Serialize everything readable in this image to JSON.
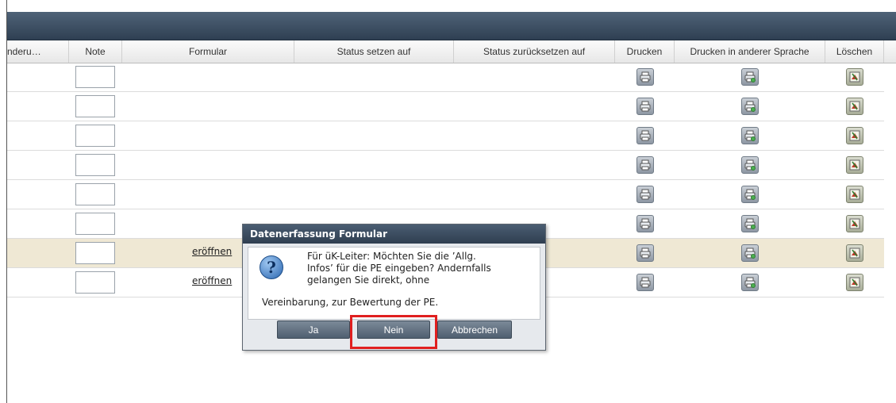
{
  "columns": [
    "nderu…",
    "Note",
    "Formular",
    "Status setzen auf",
    "Status zurücksetzen auf",
    "Drucken",
    "Drucken in anderer Sprache",
    "Löschen"
  ],
  "rows": [
    {
      "formular_link": ""
    },
    {
      "formular_link": ""
    },
    {
      "formular_link": ""
    },
    {
      "formular_link": ""
    },
    {
      "formular_link": ""
    },
    {
      "formular_link": ""
    },
    {
      "formular_link": "eröffnen",
      "highlight": true
    },
    {
      "formular_link": "eröffnen"
    }
  ],
  "icons": {
    "print": "printer-icon",
    "print_other_language": "printer-language-icon",
    "delete": "delete-icon"
  },
  "dialog": {
    "title": "Datenerfassung Formular",
    "message_line1": "Für üK-Leiter: Möchten Sie die ’Allg.",
    "message_line2": "Infos’ für die PE eingeben? Andernfalls",
    "message_line3": "gelangen Sie direkt, ohne",
    "message_line4": "Vereinbarung, zur Bewertung der PE.",
    "buttons": {
      "yes": "Ja",
      "no": "Nein",
      "cancel": "Abbrechen"
    },
    "icon": "question-icon"
  },
  "colors": {
    "highlight_row": "#efe8d4",
    "focus_ring": "#e01f1f",
    "titlebar": "#2f3e50"
  }
}
